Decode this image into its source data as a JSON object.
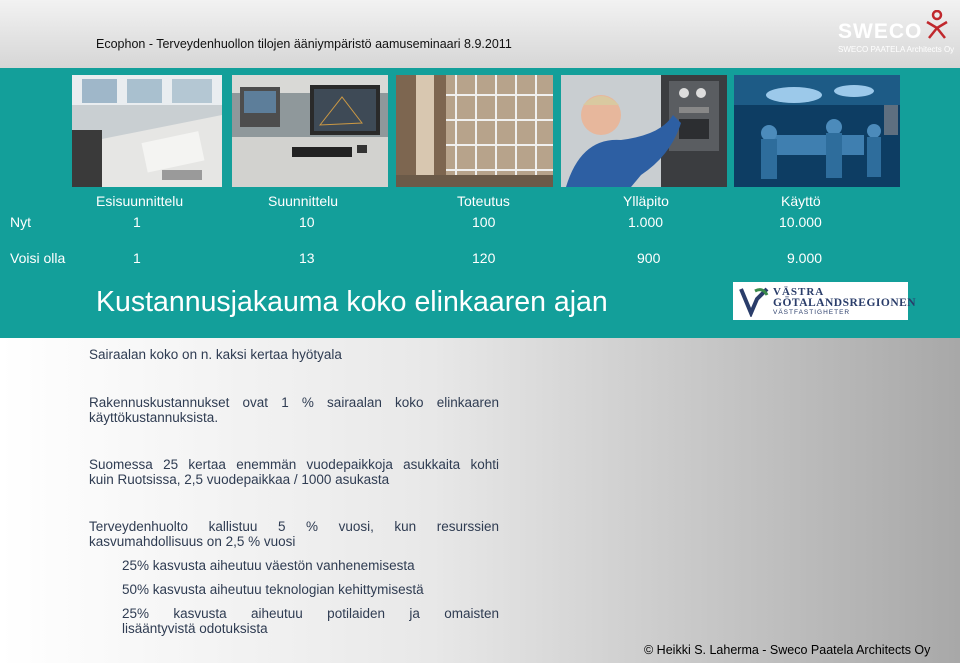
{
  "header": {
    "title": "Ecophon - Terveydenhuollon tilojen ääniympäristö aamuseminaari 8.9.2011"
  },
  "logos": {
    "sweco_word": "SWECO",
    "sweco_sub": "SWECO PAATELA Architects Oy",
    "vgr_line1": "VÄSTRA",
    "vgr_line2": "GÖTALANDSREGIONEN",
    "vgr_line3": "VÄSTFASTIGHETER"
  },
  "photos": [
    "office-desk-photo",
    "cad-workstation-photo",
    "construction-scaffold-photo",
    "technician-maintenance-photo",
    "operating-room-photo"
  ],
  "table": {
    "phases": [
      "Esisuunnittelu",
      "Suunnittelu",
      "Toteutus",
      "Ylläpito",
      "Käyttö"
    ],
    "rows": [
      {
        "label": "Nyt",
        "values": [
          "1",
          "10",
          "100",
          "1.000",
          "10.000"
        ]
      },
      {
        "label": "Voisi olla",
        "values": [
          "1",
          "13",
          "120",
          "900",
          "9.000"
        ]
      }
    ]
  },
  "main_title": "Kustannusjakauma koko elinkaaren ajan",
  "body": {
    "p1": "Sairaalan koko on n. kaksi kertaa hyötyala",
    "p2a": "Rakennuskustannukset ovat 1 % sairaalan koko elinkaaren",
    "p2b": "käyttökustannuksista.",
    "p3a": "Suomessa 25 kertaa enemmän vuodepaikkoja asukkaita kohti",
    "p3b": "kuin Ruotsissa, 2,5 vuodepaikkaa / 1000 asukasta",
    "p4a": "Terveydenhuolto kallistuu 5 % vuosi, kun resurssien",
    "p4b": "kasvumahdollisuus on 2,5 % vuosi",
    "sub1": "25% kasvusta aiheutuu väestön vanhenemisesta",
    "sub2": "50% kasvusta aiheutuu teknologian kehittymisestä",
    "sub3a": "25% kasvusta aiheutuu potilaiden ja omaisten",
    "sub3b": "lisääntyvistä odotuksista"
  },
  "footer": "© Heikki S. Laherma - Sweco Paatela Architects Oy"
}
